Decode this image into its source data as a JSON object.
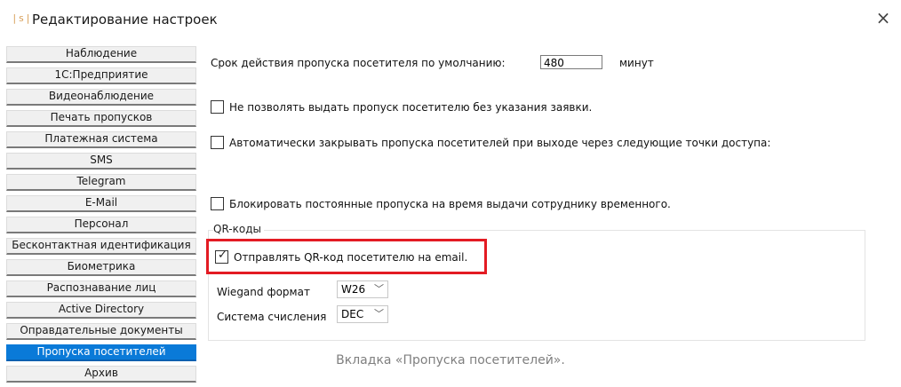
{
  "window": {
    "icon_text": "|s|",
    "title": "Редактирование настроек",
    "close_glyph": "×"
  },
  "tabs": [
    {
      "label": "Наблюдение",
      "active": false
    },
    {
      "label": "1С:Предприятие",
      "active": false
    },
    {
      "label": "Видеонаблюдение",
      "active": false
    },
    {
      "label": "Печать пропусков",
      "active": false
    },
    {
      "label": "Платежная система",
      "active": false
    },
    {
      "label": "SMS",
      "active": false
    },
    {
      "label": "Telegram",
      "active": false
    },
    {
      "label": "E-Mail",
      "active": false
    },
    {
      "label": "Персонал",
      "active": false
    },
    {
      "label": "Бесконтактная идентификация",
      "active": false
    },
    {
      "label": "Биометрика",
      "active": false
    },
    {
      "label": "Распознавание лиц",
      "active": false
    },
    {
      "label": "Active Directory",
      "active": false
    },
    {
      "label": "Оправдательные документы",
      "active": false
    },
    {
      "label": "Пропуска посетителей",
      "active": true
    },
    {
      "label": "Архив",
      "active": false
    }
  ],
  "settings": {
    "default_duration_label": "Срок действия пропуска посетителя по умолчанию:",
    "default_duration_value": "480",
    "default_duration_unit": "минут",
    "no_pass_without_request": {
      "label": "Не позволять выдать пропуск посетителю без указания заявки.",
      "checked": false
    },
    "auto_close_on_exit": {
      "label": "Автоматически закрывать пропуска посетителей при выходе через следующие точки доступа:",
      "checked": false
    },
    "block_permanent_passes": {
      "label": "Блокировать постоянные пропуска на время выдачи сотруднику временного.",
      "checked": false
    }
  },
  "qr_group": {
    "title": "QR-коды",
    "send_qr_email": {
      "label": "Отправлять QR-код посетителю на email.",
      "checked": true
    },
    "wiegand_label": "Wiegand формат",
    "wiegand_value": "W26",
    "numbering_label": "Система счисления",
    "numbering_value": "DEC"
  },
  "caption": "Вкладка «Пропуска посетителей».",
  "colors": {
    "accent": "#0a7ad8",
    "highlight_border": "#e31b23"
  }
}
